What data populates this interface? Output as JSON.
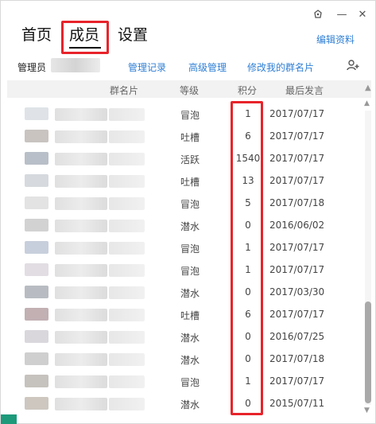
{
  "window_controls": {
    "skin_icon": "skin-icon",
    "min_glyph": "—",
    "close_glyph": "✕"
  },
  "tabs": [
    {
      "label": "首页"
    },
    {
      "label": "成员"
    },
    {
      "label": "设置"
    }
  ],
  "edit_profile": "编辑资料",
  "toolbar": {
    "admin_label": "管理员",
    "links": [
      "管理记录",
      "高级管理",
      "修改我的群名片"
    ],
    "add_member_icon": "add-person-icon"
  },
  "table": {
    "columns": [
      "群名片",
      "等级",
      "积分",
      "最后发言"
    ],
    "rows": [
      {
        "level": "冒泡",
        "points": "1",
        "last": "2017/07/17"
      },
      {
        "level": "吐槽",
        "points": "6",
        "last": "2017/07/17"
      },
      {
        "level": "活跃",
        "points": "1540",
        "last": "2017/07/17"
      },
      {
        "level": "吐槽",
        "points": "13",
        "last": "2017/07/17"
      },
      {
        "level": "冒泡",
        "points": "5",
        "last": "2017/07/18"
      },
      {
        "level": "潜水",
        "points": "0",
        "last": "2016/06/02"
      },
      {
        "level": "冒泡",
        "points": "1",
        "last": "2017/07/17"
      },
      {
        "level": "冒泡",
        "points": "1",
        "last": "2017/07/17"
      },
      {
        "level": "潜水",
        "points": "0",
        "last": "2017/03/30"
      },
      {
        "level": "吐槽",
        "points": "6",
        "last": "2017/07/17"
      },
      {
        "level": "潜水",
        "points": "0",
        "last": "2016/07/25"
      },
      {
        "level": "潜水",
        "points": "0",
        "last": "2017/07/18"
      },
      {
        "level": "冒泡",
        "points": "1",
        "last": "2017/07/17"
      },
      {
        "level": "潜水",
        "points": "0",
        "last": "2015/07/11"
      }
    ]
  },
  "colors": {
    "accent_link": "#2f7fd5",
    "highlight": "#e8232a",
    "header_bg": "#f2f2f2"
  }
}
